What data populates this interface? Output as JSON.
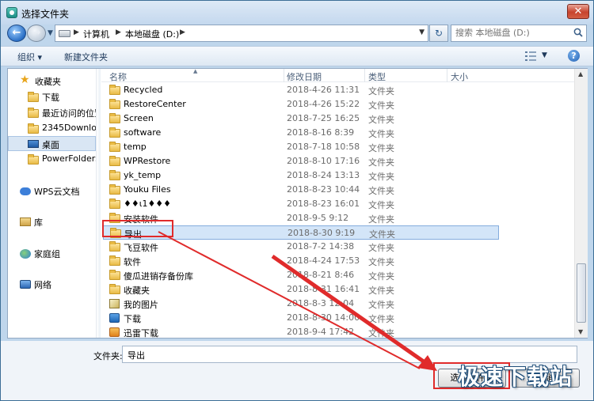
{
  "window": {
    "title": "选择文件夹",
    "close_label": "✕"
  },
  "nav": {
    "breadcrumbs": [
      "计算机",
      "本地磁盘 (D:)"
    ],
    "search_placeholder": "搜索 本地磁盘 (D:)"
  },
  "toolbar": {
    "organize": "组织 ▾",
    "new_folder": "新建文件夹"
  },
  "sidebar": {
    "items": [
      {
        "label": "收藏夹",
        "icon": "star-icon"
      },
      {
        "label": "下载",
        "icon": "folder-icon"
      },
      {
        "label": "最近访问的位置",
        "icon": "folder-icon"
      },
      {
        "label": "2345Downloads",
        "icon": "folder-icon"
      },
      {
        "label": "桌面",
        "icon": "desktop-icon"
      },
      {
        "label": "PowerFolders",
        "icon": "folder-icon"
      },
      {
        "label": "WPS云文档",
        "icon": "cloud-icon"
      },
      {
        "label": "库",
        "icon": "library-icon"
      },
      {
        "label": "家庭组",
        "icon": "homegroup-icon"
      },
      {
        "label": "网络",
        "icon": "network-icon"
      }
    ]
  },
  "columns": {
    "name": "名称",
    "date": "修改日期",
    "type": "类型",
    "size": "大小"
  },
  "files": [
    {
      "name": "Recycled",
      "date": "2018-4-26 11:31",
      "type": "文件夹",
      "icon": "folder-icon"
    },
    {
      "name": "RestoreCenter",
      "date": "2018-4-26 15:22",
      "type": "文件夹",
      "icon": "folder-icon"
    },
    {
      "name": "Screen",
      "date": "2018-7-25 16:25",
      "type": "文件夹",
      "icon": "folder-icon"
    },
    {
      "name": "software",
      "date": "2018-8-16 8:39",
      "type": "文件夹",
      "icon": "folder-icon"
    },
    {
      "name": "temp",
      "date": "2018-7-18 10:58",
      "type": "文件夹",
      "icon": "folder-icon"
    },
    {
      "name": "WPRestore",
      "date": "2018-8-10 17:16",
      "type": "文件夹",
      "icon": "folder-icon"
    },
    {
      "name": "yk_temp",
      "date": "2018-8-24 13:13",
      "type": "文件夹",
      "icon": "folder-icon"
    },
    {
      "name": "Youku Files",
      "date": "2018-8-23 10:44",
      "type": "文件夹",
      "icon": "folder-icon"
    },
    {
      "name": "♦♦ι1♦♦♦",
      "date": "2018-8-23 16:01",
      "type": "文件夹",
      "icon": "folder-icon"
    },
    {
      "name": "安装软件",
      "date": "2018-9-5 9:12",
      "type": "文件夹",
      "icon": "folder-icon"
    },
    {
      "name": "导出",
      "date": "2018-8-30 9:19",
      "type": "文件夹",
      "icon": "folder-icon",
      "selected": true
    },
    {
      "name": "飞豆软件",
      "date": "2018-7-2 14:38",
      "type": "文件夹",
      "icon": "folder-icon"
    },
    {
      "name": "软件",
      "date": "2018-4-24 17:53",
      "type": "文件夹",
      "icon": "folder-icon"
    },
    {
      "name": "傻瓜进销存备份库",
      "date": "2018-8-21 8:46",
      "type": "文件夹",
      "icon": "folder-icon"
    },
    {
      "name": "收藏夹",
      "date": "2018-8-31 16:41",
      "type": "文件夹",
      "icon": "folder-icon"
    },
    {
      "name": "我的图片",
      "date": "2018-8-3 12:04",
      "type": "文件夹",
      "icon": "pictures-icon"
    },
    {
      "name": "下载",
      "date": "2018-8-30 14:00",
      "type": "文件夹",
      "icon": "download-icon"
    },
    {
      "name": "迅雷下载",
      "date": "2018-9-4 17:42",
      "type": "文件夹",
      "icon": "xunlei-icon"
    }
  ],
  "bottom": {
    "folder_label": "文件夹:",
    "folder_value": "导出",
    "select_button": "选择文件夹",
    "cancel_button": "取消"
  },
  "watermark": "极速下载站",
  "colors": {
    "annotation": "#e02b2b",
    "selection": "#d3e5f8",
    "chrome": "#bfd6ec"
  }
}
